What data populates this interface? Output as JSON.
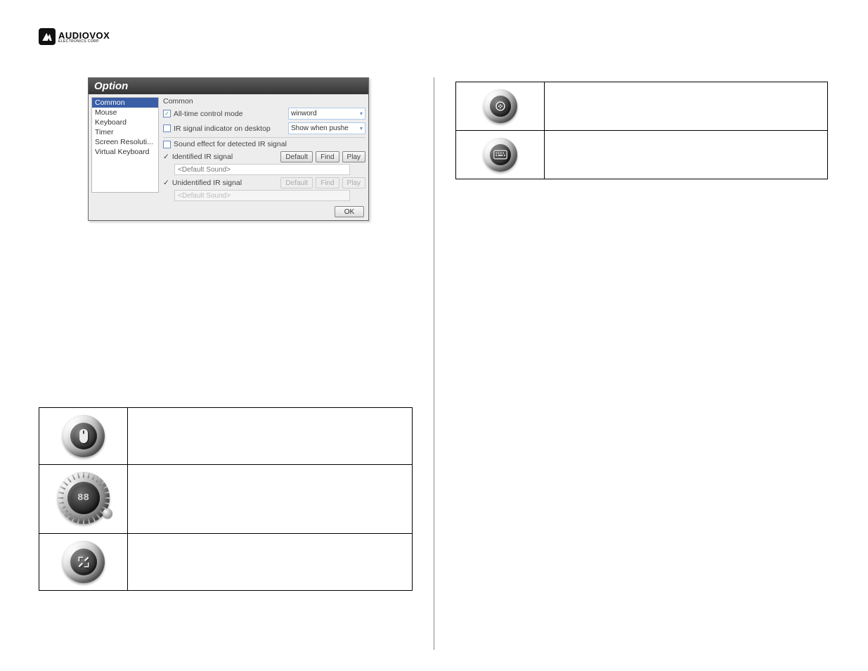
{
  "logo": {
    "brand": "AUDIOVOX",
    "sub": "ELECTRONICS CORP."
  },
  "dialog": {
    "title": "Option",
    "sidebar": [
      "Common",
      "Mouse",
      "Keyboard",
      "Timer",
      "Screen Resoluti...",
      "Virtual Keyboard"
    ],
    "section_label": "Common",
    "alltime_label": "All-time control mode",
    "alltime_value": "winword",
    "indicator_label": "IR signal indicator on desktop",
    "indicator_value": "Show when pushe",
    "sound_group_label": "Sound effect for detected IR signal",
    "identified_label": "Identified IR signal",
    "unidentified_label": "Unidentified IR signal",
    "default_btn": "Default",
    "find_btn": "Find",
    "play_btn": "Play",
    "default_sound": "<Default Sound>",
    "ok": "OK"
  },
  "left_icons": {
    "mouse_desc": "",
    "timer_badge": "88",
    "timer_desc": "",
    "resolution_desc": ""
  },
  "right_icons": {
    "mcebutton_desc": "",
    "keyboard_desc": ""
  }
}
